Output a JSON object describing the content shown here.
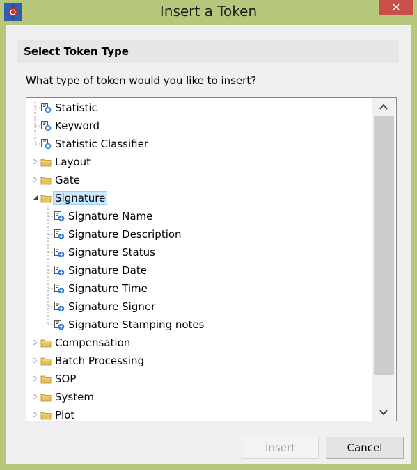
{
  "window": {
    "title": "Insert a Token",
    "close_glyph": "✕"
  },
  "header": {
    "title": "Select Token Type"
  },
  "question": "What type of token would you like to insert?",
  "tree": {
    "root_items": [
      {
        "label": "Statistic",
        "icon": "token-icon"
      },
      {
        "label": "Keyword",
        "icon": "token-icon"
      },
      {
        "label": "Statistic Classifier",
        "icon": "token-icon"
      },
      {
        "label": "Layout",
        "icon": "folder-icon"
      },
      {
        "label": "Gate",
        "icon": "folder-icon"
      },
      {
        "label": "Signature",
        "icon": "folder-icon",
        "expanded": true,
        "selected": true
      },
      {
        "label": "Compensation",
        "icon": "folder-icon"
      },
      {
        "label": "Batch Processing",
        "icon": "folder-icon"
      },
      {
        "label": "SOP",
        "icon": "folder-icon"
      },
      {
        "label": "System",
        "icon": "folder-icon"
      },
      {
        "label": "Plot",
        "icon": "folder-icon"
      }
    ],
    "signature_children": [
      {
        "label": "Signature Name",
        "icon": "token-icon"
      },
      {
        "label": "Signature Description",
        "icon": "token-icon"
      },
      {
        "label": "Signature Status",
        "icon": "token-icon"
      },
      {
        "label": "Signature Date",
        "icon": "token-icon"
      },
      {
        "label": "Signature Time",
        "icon": "token-icon"
      },
      {
        "label": "Signature Signer",
        "icon": "token-icon"
      },
      {
        "label": "Signature Stamping notes",
        "icon": "token-icon"
      }
    ]
  },
  "buttons": {
    "insert": "Insert",
    "cancel": "Cancel"
  },
  "colors": {
    "title_bar": "#b7c77c",
    "close_button": "#c7504a",
    "selection": "#cce8ff",
    "folder": "#e9c35a",
    "token_blue": "#2a7ad6"
  }
}
